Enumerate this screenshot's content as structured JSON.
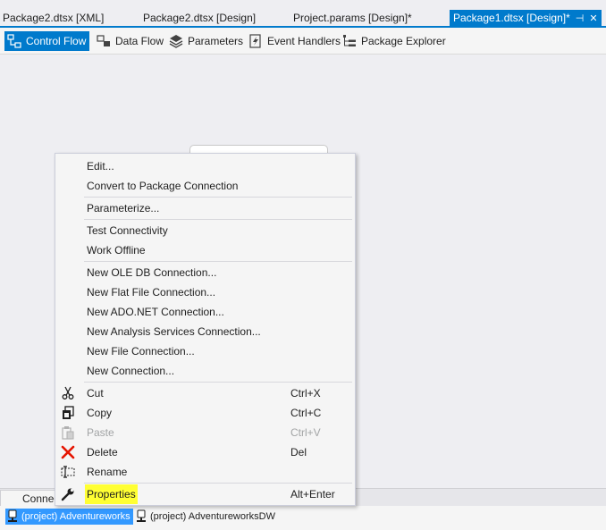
{
  "doc_tabs": [
    {
      "label": "Package2.dtsx [XML]"
    },
    {
      "label": "Package2.dtsx [Design]"
    },
    {
      "label": "Project.params [Design]*"
    },
    {
      "label": "Package1.dtsx [Design]*",
      "pin": "⊣",
      "close": "✕"
    }
  ],
  "designer_tabs": [
    {
      "label": "Control Flow",
      "icon": "control-flow-icon"
    },
    {
      "label": "Data Flow",
      "icon": "data-flow-icon"
    },
    {
      "label": "Parameters",
      "icon": "parameters-icon"
    },
    {
      "label": "Event Handlers",
      "icon": "event-handlers-icon"
    },
    {
      "label": "Package Explorer",
      "icon": "package-explorer-icon"
    }
  ],
  "connection_tab": {
    "label": "Connec"
  },
  "connections": [
    {
      "label": "(project) Adventureworks",
      "icon": "connection-icon"
    },
    {
      "label": "(project) AdventureworksDW",
      "icon": "connection-icon"
    }
  ],
  "context_menu": {
    "items": [
      {
        "label": "Edit..."
      },
      {
        "label": "Convert to Package Connection"
      },
      {
        "label": "Parameterize..."
      },
      {
        "label": "Test Connectivity"
      },
      {
        "label": "Work Offline"
      },
      {
        "label": "New OLE DB Connection..."
      },
      {
        "label": "New Flat File Connection..."
      },
      {
        "label": "New ADO.NET Connection..."
      },
      {
        "label": "New Analysis Services Connection..."
      },
      {
        "label": "New File Connection..."
      },
      {
        "label": "New Connection..."
      },
      {
        "label": "Cut",
        "shortcut": "Ctrl+X",
        "icon": "scissors-icon"
      },
      {
        "label": "Copy",
        "shortcut": "Ctrl+C",
        "icon": "copy-icon"
      },
      {
        "label": "Paste",
        "shortcut": "Ctrl+V",
        "icon": "paste-icon",
        "disabled": true
      },
      {
        "label": "Delete",
        "shortcut": "Del",
        "icon": "delete-icon"
      },
      {
        "label": "Rename",
        "icon": "rename-icon"
      },
      {
        "label": "Properties",
        "shortcut": "Alt+Enter",
        "icon": "wrench-icon",
        "highlighted": true
      }
    ]
  },
  "colors": {
    "accent": "#007acc",
    "highlight": "#ffff33",
    "selection": "#3399ff",
    "delete_red": "#e51400"
  }
}
